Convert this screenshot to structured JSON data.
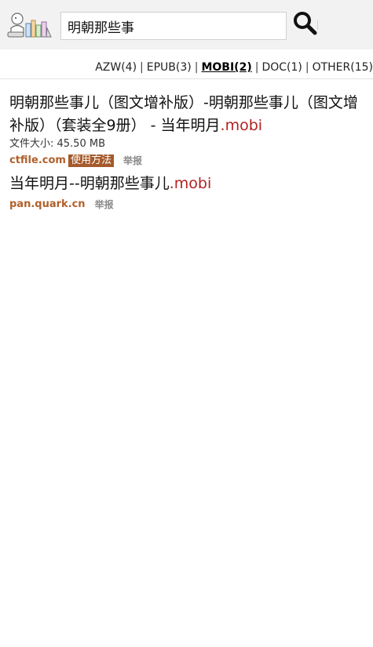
{
  "search": {
    "value": "明朝那些事"
  },
  "filters": [
    {
      "label": "AZW(4)",
      "active": false
    },
    {
      "label": "EPUB(3)",
      "active": false
    },
    {
      "label": "MOBI(2)",
      "active": true
    },
    {
      "label": "DOC(1)",
      "active": false
    },
    {
      "label": "OTHER(15)",
      "active": false
    }
  ],
  "filter_separator": "|",
  "results": [
    {
      "title": "明朝那些事儿（图文增补版）-明朝那些事儿（图文增补版）（套装全9册） - 当年明月",
      "ext": ".mobi",
      "size": "文件大小: 45.50 MB",
      "domain": "ctfile.com",
      "usage": "使用方法",
      "report": "举报"
    },
    {
      "title": "当年明月--明朝那些事儿",
      "ext": ".mobi",
      "domain": "pan.quark.cn",
      "report": "举报"
    }
  ],
  "colors": {
    "ext": "#b22222",
    "domain": "#b0602a",
    "usage_bg": "#a55a2b",
    "report": "#8a8a8a"
  },
  "icons": {
    "logo": "reading-figure-logo",
    "search": "magnifier-icon"
  }
}
